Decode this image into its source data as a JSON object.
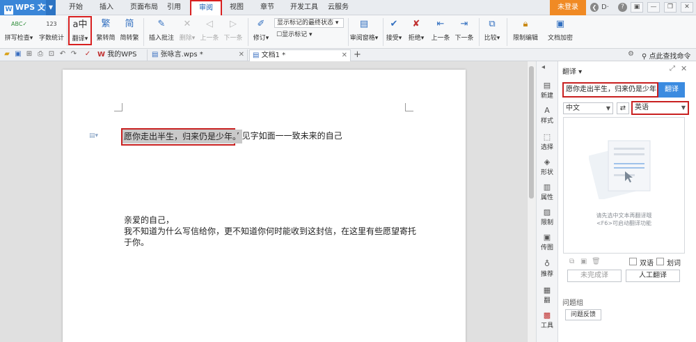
{
  "app": {
    "name": "WPS 文字",
    "logo_letter": "W",
    "login": "未登录"
  },
  "menu": [
    "开始",
    "插入",
    "页面布局",
    "引用",
    "审阅",
    "视图",
    "章节",
    "开发工具",
    "云服务"
  ],
  "window_controls": [
    "▣",
    "—",
    "❐",
    "✕"
  ],
  "title_icons": {
    "back": "❮",
    "skin": "D·",
    "help": "?"
  },
  "ribbon": {
    "spell_check": "拼写检查",
    "word_count": "字数统计",
    "translate": "翻译",
    "simp_to_trad": "繁转简",
    "trad_to_simp": "简转繁",
    "insert_comment": "插入批注",
    "delete": "删除",
    "prev_comment": "上一条",
    "next_comment": "下一条",
    "revise": "修订",
    "markup_state": "显示标记的最终状态",
    "show_markup": "显示标记",
    "review_pane": "审阅窗格",
    "accept": "接受",
    "reject": "拒绝",
    "prev_change": "上一条",
    "next_change": "下一条",
    "compare": "比较",
    "restrict_edit": "限制编辑",
    "doc_encrypt": "文档加密"
  },
  "tabs": {
    "my_wps": "我的WPS",
    "doc1": "张咏言.wps *",
    "doc2": "文档1 *",
    "find_cmd": "点此查找命令"
  },
  "document": {
    "selected_text": "愿你走出半生，归来仍是少年。",
    "rest_of_line": "’  见字如面一一致未来的自己",
    "greeting": "亲爱的自己，",
    "body_line1": "我不知道为什么写信给你，更不知道你何时能收到这封信，在这里有些愿望寄托",
    "body_line2": "于你。"
  },
  "sidebar": [
    "新建",
    "样式",
    "选择",
    "形状",
    "属性",
    "限制",
    "传图",
    "推荐",
    "翻",
    "工具"
  ],
  "panel": {
    "title": "翻译",
    "input_text": "愿你走出半生，归来仍是少年",
    "translate_btn": "翻译",
    "source_lang": "中文",
    "target_lang": "英语",
    "hint_line1": "请先选中文本再翻译哦",
    "hint_line2": "<F6>可启动翻译功能",
    "bilingual": "双语",
    "word_translation": "划词",
    "machine_translate": "未完成译",
    "human_translate": "人工翻译",
    "feedback": "问题反馈",
    "partial_label": "问题组"
  },
  "colors": {
    "accent": "#3a86d8",
    "highlight_border": "#d82020",
    "login": "#f08a24"
  }
}
